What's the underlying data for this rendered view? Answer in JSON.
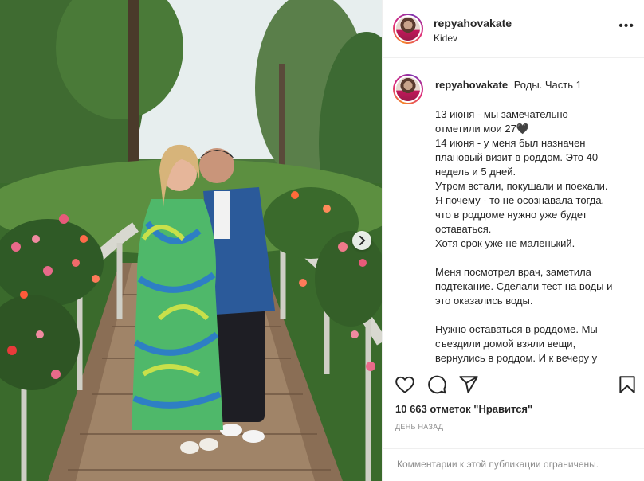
{
  "post": {
    "username": "repyahovakate",
    "location": "Kidev",
    "more_label": "•••",
    "image_alt": "Пара на мосту в саду"
  },
  "caption": {
    "username": "repyahovakate",
    "title": "Роды. Часть 1",
    "paragraphs": [
      [
        "13 июня - мы замечательно",
        "отметили мои 27🖤",
        "14 июня - у меня был назначен",
        "плановый визит в роддом. Это 40",
        "недель и 5 дней.",
        "Утром встали, покушали и поехали.",
        "Я почему - то не осознавала тогда,",
        "что в роддоме нужно уже будет",
        "оставаться.",
        "Хотя срок уже не маленький."
      ],
      [
        "Меня посмотрел врач, заметила",
        "подтекание. Сделали тест на воды и",
        "это оказались воды."
      ],
      [
        "Нужно оставаться в роддоме. Мы",
        "съездили домой взяли вещи,",
        "вернулись в роддом. И к вечеру у"
      ]
    ]
  },
  "actions": {
    "icons": [
      "heart-icon",
      "comment-icon",
      "share-icon",
      "bookmark-icon"
    ],
    "likes_text": "10 663 отметок \"Нравится\"",
    "time_ago": "ДЕНЬ НАЗАД"
  },
  "comments": {
    "limited_text": "Комментарии к этой публикации ограничены."
  },
  "colors": {
    "text": "#262626",
    "secondary": "#8e8e8e",
    "border": "#efefef",
    "heart_glyph": "#000000"
  }
}
